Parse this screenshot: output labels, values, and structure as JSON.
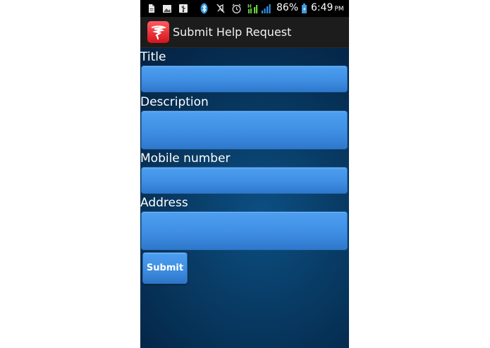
{
  "status_bar": {
    "battery_percent": "86%",
    "time": "6:49",
    "ampm": "PM",
    "icons": [
      "notification-doc-icon",
      "gallery-icon",
      "usb-icon",
      "bluetooth-icon",
      "mute-icon",
      "alarm-icon",
      "hspa-data-icon",
      "signal-icon",
      "battery-charging-icon"
    ]
  },
  "action_bar": {
    "title": "Submit Help Request",
    "app_icon": "twister-logo-icon",
    "app_icon_color": "#e8232a"
  },
  "form": {
    "title_label": "Title",
    "title_value": "",
    "description_label": "Description",
    "description_value": "",
    "mobile_label": "Mobile number",
    "mobile_value": "",
    "address_label": "Address",
    "address_value": "",
    "submit_label": "Submit"
  },
  "colors": {
    "field_fill": "#4a9bec",
    "background": "#083a63"
  }
}
